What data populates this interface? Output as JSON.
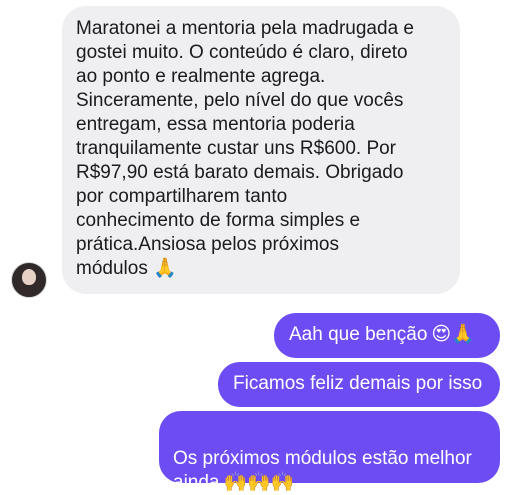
{
  "chat": {
    "incoming": {
      "text": "Maratonei a mentoria pela madrugada e\ngostei muito. O conteúdo é claro, direto\nao ponto e realmente agrega.\nSinceramente, pelo nível do que vocês\nentregam, essa mentoria poderia\ntranquilamente custar uns R$600. Por\nR$97,90 está barato demais. Obrigado\npor compartilharem tanto\nconhecimento de forma simples e\nprática.Ansiosa pelos próximos\nmódulos 🙏"
    },
    "outgoing": [
      {
        "text": "Aah que benção",
        "emoji": "😍🙏"
      },
      {
        "text": "Ficamos feliz demais por isso"
      },
      {
        "text": "Os próximos módulos estão melhor\nainda",
        "emoji": "🙌🙌🙌"
      }
    ]
  },
  "avatar_icon": "profile-avatar"
}
